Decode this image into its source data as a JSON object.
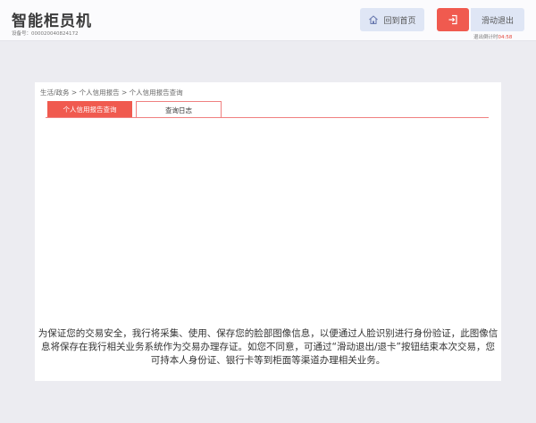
{
  "header": {
    "title": "智能柜员机",
    "device_no": "设备号：000020040824172",
    "home_label": "回到首页",
    "exit_label": "滑动退出",
    "countdown_label": "退出倒计时",
    "countdown_time": "04:58"
  },
  "panel": {
    "breadcrumb": "生活/政务 > 个人信用报告 > 个人信用报告查询",
    "tabs": [
      {
        "label": "个人信用报告查询",
        "active": true
      },
      {
        "label": "查询日志",
        "active": false
      }
    ],
    "notice": "为保证您的交易安全，我行将采集、使用、保存您的脸部图像信息，以便通过人脸识别进行身份验证，此图像信息将保存在我行相关业务系统作为交易办理存证。如您不同意，可通过“滑动退出/退卡”按钮结束本次交易，您可持本人身份证、银行卡等到柜面等渠道办理相关业务。"
  },
  "colors": {
    "accent": "#f05a4f",
    "button_bg": "#dfe6f5",
    "page_bg": "#ececf1"
  },
  "icons": {
    "home": "home-icon",
    "exit": "exit-icon"
  }
}
